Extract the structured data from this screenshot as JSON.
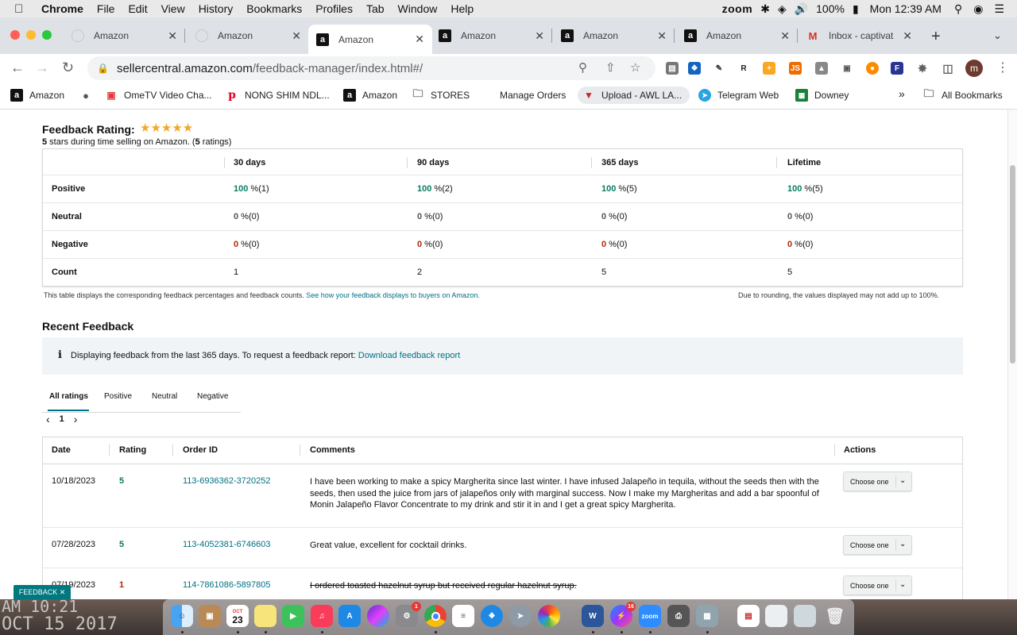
{
  "menubar": {
    "app": "Chrome",
    "items": [
      "File",
      "Edit",
      "View",
      "History",
      "Bookmarks",
      "Profiles",
      "Tab",
      "Window",
      "Help"
    ],
    "zoom": "zoom",
    "battery": "100%",
    "datetime": "Mon 12:39 AM"
  },
  "tabs": [
    {
      "title": "Amazon"
    },
    {
      "title": "Amazon"
    },
    {
      "title": "Amazon"
    },
    {
      "title": "Amazon"
    },
    {
      "title": "Amazon"
    },
    {
      "title": "Amazon"
    },
    {
      "title": "Inbox - captivat"
    }
  ],
  "omnibox": {
    "domain": "sellercentral.amazon.com",
    "path": "/feedback-manager/index.html#/"
  },
  "profile_initial": "m",
  "bookmarks": [
    {
      "label": "Amazon"
    },
    {
      "label": "OmeTV Video Cha..."
    },
    {
      "label": "NONG SHIM NDL..."
    },
    {
      "label": "Amazon"
    },
    {
      "label": "STORES"
    },
    {
      "label": "Manage Orders"
    },
    {
      "label": "Upload - AWL LA..."
    },
    {
      "label": "Telegram Web"
    },
    {
      "label": "Downey"
    }
  ],
  "bookmarks_overflow": "»",
  "all_bookmarks": "All Bookmarks",
  "feedback_rating": {
    "title": "Feedback Rating:",
    "stars": "★★★★★",
    "sub_stars": "5",
    "sub_text_1": " stars during time selling on Amazon. (",
    "sub_count": "5",
    "sub_text_2": " ratings)"
  },
  "ratings_table": {
    "columns": [
      "30 days",
      "90 days",
      "365 days",
      "Lifetime"
    ],
    "rows": [
      {
        "label": "Positive",
        "cells": [
          {
            "n": "100",
            "r": " %(1)"
          },
          {
            "n": "100",
            "r": " %(2)"
          },
          {
            "n": "100",
            "r": " %(5)"
          },
          {
            "n": "100",
            "r": " %(5)"
          }
        ]
      },
      {
        "label": "Neutral",
        "cells": [
          {
            "n": "0",
            "r": " %(0)"
          },
          {
            "n": "0",
            "r": " %(0)"
          },
          {
            "n": "0",
            "r": " %(0)"
          },
          {
            "n": "0",
            "r": " %(0)"
          }
        ]
      },
      {
        "label": "Negative",
        "cells": [
          {
            "n": "0",
            "r": " %(0)"
          },
          {
            "n": "0",
            "r": " %(0)"
          },
          {
            "n": "0",
            "r": " %(0)"
          },
          {
            "n": "0",
            "r": " %(0)"
          }
        ]
      },
      {
        "label": "Count",
        "cells": [
          {
            "n": "1"
          },
          {
            "n": "2"
          },
          {
            "n": "5"
          },
          {
            "n": "5"
          }
        ]
      }
    ],
    "footnote_left": "This table displays the corresponding feedback percentages and feedback counts.",
    "footnote_link": "See how your feedback displays to buyers on Amazon.",
    "footnote_right": "Due to rounding, the values displayed may not add up to 100%."
  },
  "recent_feedback": {
    "title": "Recent Feedback",
    "info_icon": "i",
    "info_text": "Displaying feedback from the last 365 days. To request a feedback report:",
    "info_link": "Download feedback report",
    "filter_tabs": [
      "All ratings",
      "Positive",
      "Neutral",
      "Negative"
    ],
    "pager": {
      "prev": "‹",
      "page": "1",
      "next": "›"
    },
    "columns": [
      "Date",
      "Rating",
      "Order ID",
      "Comments",
      "Actions"
    ],
    "rows": [
      {
        "date": "10/18/2023",
        "rating": "5",
        "order_id": "113-6936362-3720252",
        "comment": "I have been working to make a spicy Margherita since last winter. I have infused Jalapeño in tequila, without the seeds then with the seeds, then used the juice from jars of jalapeños only with marginal success. Now I make my Margheritas and add a bar spoonful of Monin Jalapeño Flavor Concentrate to my drink and stir it in and I get a great spicy Margherita.",
        "action": "Choose one"
      },
      {
        "date": "07/28/2023",
        "rating": "5",
        "order_id": "113-4052381-6746603",
        "comment": "Great value, excellent for cocktail drinks.",
        "action": "Choose one"
      },
      {
        "date": "07/19/2023",
        "rating": "1",
        "order_id": "114-7861086-5897805",
        "comment": "I ordered toasted hazelnut syrup but received regular hazelnut syrup.",
        "action": "Choose one"
      }
    ]
  },
  "feedback_chip": "FEEDBACK ✕",
  "desktop_clock": {
    "line1": "AM 10:21",
    "line2": "OCT 15 2017"
  },
  "dock": {
    "calendar_month": "OCT",
    "calendar_day": "23",
    "zoom": "zoom",
    "badge_sysprefs": "1",
    "badge_messenger": "16"
  },
  "colors": {
    "positive": "#067d62",
    "negative": "#b12704",
    "link": "#007185",
    "chip": "#00787f"
  }
}
